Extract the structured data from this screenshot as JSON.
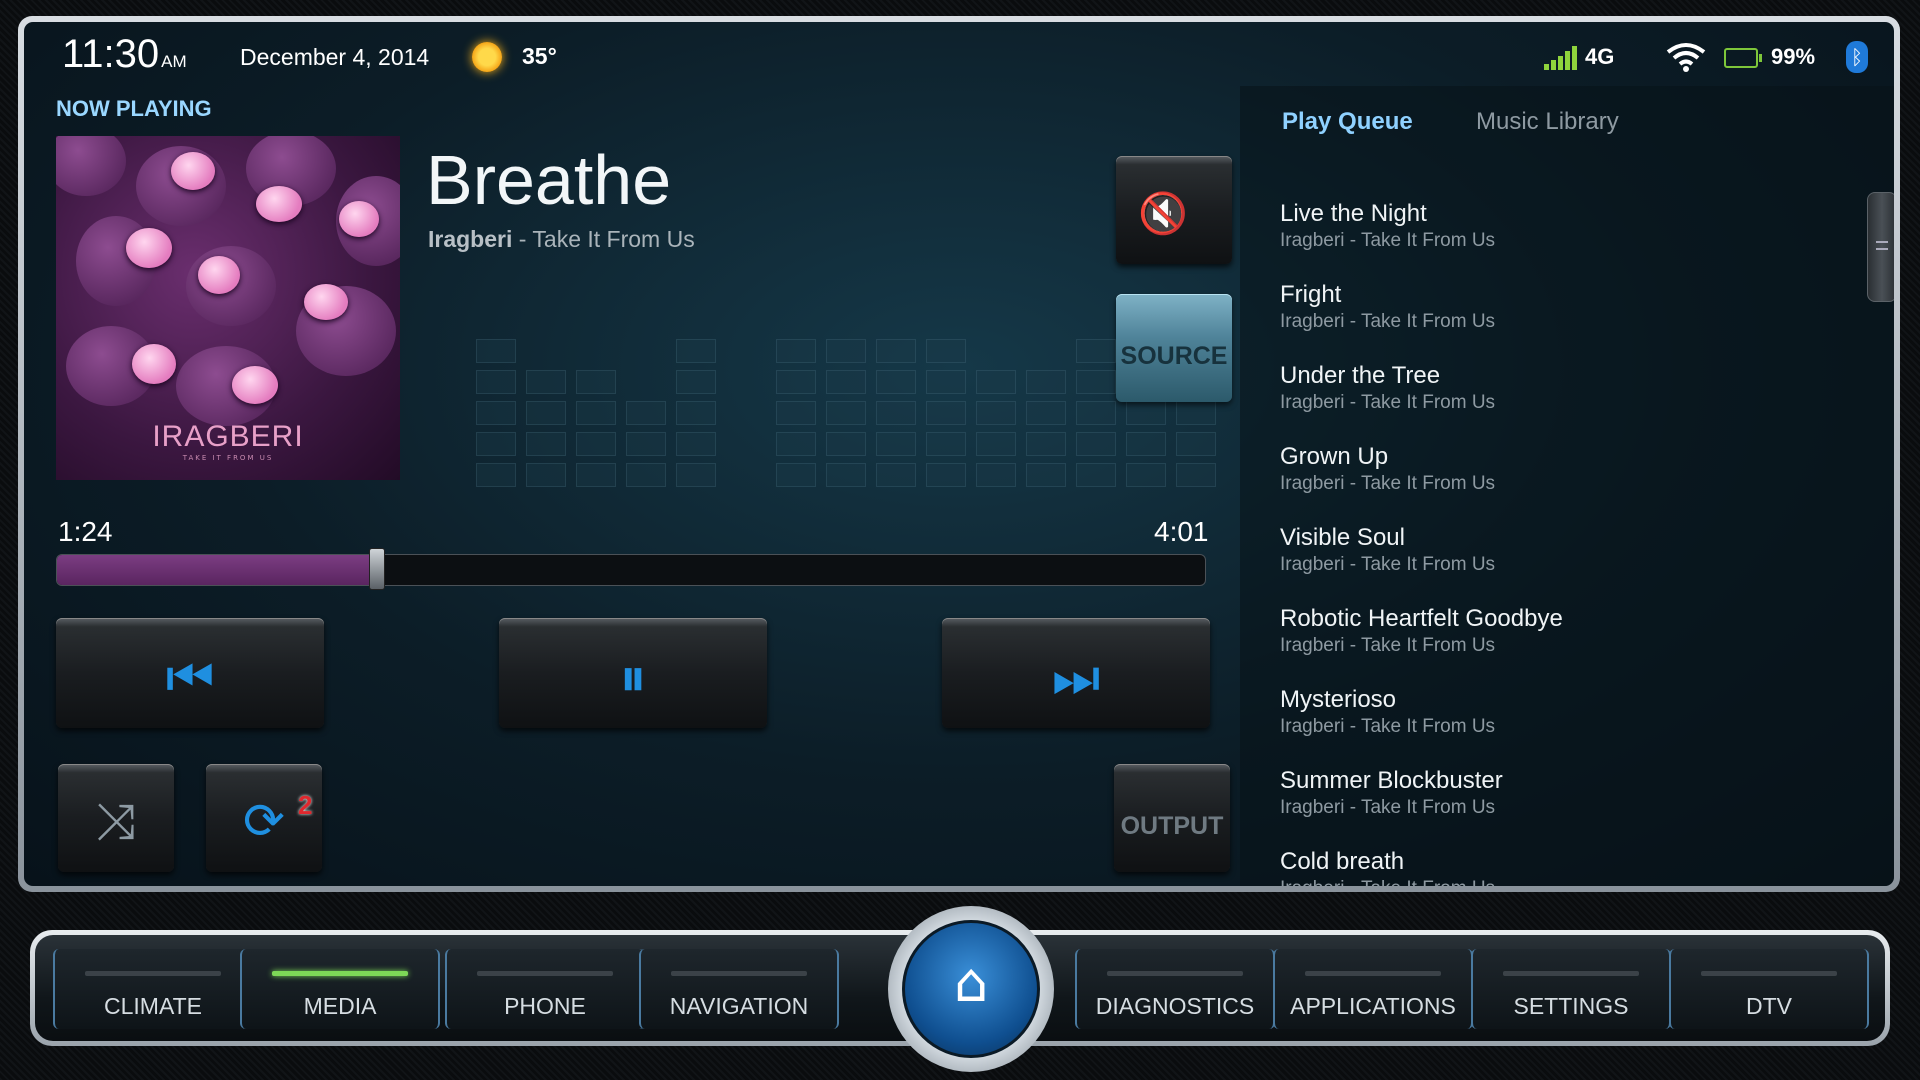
{
  "status": {
    "time": "11:30",
    "ampm": "AM",
    "date": "December 4, 2014",
    "temperature": "35°",
    "network": "4G",
    "battery": "99%"
  },
  "now_playing": {
    "label": "NOW PLAYING",
    "title": "Breathe",
    "artist": "Iragberi",
    "album_sep": " - Take It From Us",
    "album_art_text": "IRAGBERI",
    "album_art_sub": "TAKE IT FROM US",
    "elapsed": "1:24",
    "duration": "4:01",
    "progress_fraction": 0.279
  },
  "buttons": {
    "source": "SOURCE",
    "output": "OUTPUT",
    "repeat_badge": "2"
  },
  "queue": {
    "tabs": [
      "Play Queue",
      "Music Library"
    ],
    "items": [
      {
        "name": "Live the Night",
        "sub": "Iragberi - Take It From Us"
      },
      {
        "name": "Fright",
        "sub": "Iragberi - Take It From Us"
      },
      {
        "name": "Under the Tree",
        "sub": "Iragberi - Take It From Us"
      },
      {
        "name": "Grown Up",
        "sub": "Iragberi - Take It From Us"
      },
      {
        "name": "Visible Soul",
        "sub": "Iragberi - Take It From Us"
      },
      {
        "name": "Robotic Heartfelt Goodbye",
        "sub": "Iragberi - Take It From Us"
      },
      {
        "name": "Mysterioso",
        "sub": "Iragberi - Take It From Us"
      },
      {
        "name": "Summer Blockbuster",
        "sub": "Iragberi - Take It From Us"
      },
      {
        "name": "Cold breath",
        "sub": "Iragberi - Take It From Us"
      }
    ]
  },
  "dock": {
    "left": [
      "CLIMATE",
      "MEDIA",
      "PHONE",
      "NAVIGATION"
    ],
    "right": [
      "DIAGNOSTICS",
      "APPLICATIONS",
      "SETTINGS",
      "DTV"
    ],
    "active": "MEDIA"
  },
  "colors": {
    "accent": "#1f8fe0",
    "progress": "#7b3d82",
    "active_indicator": "#7ed957"
  }
}
